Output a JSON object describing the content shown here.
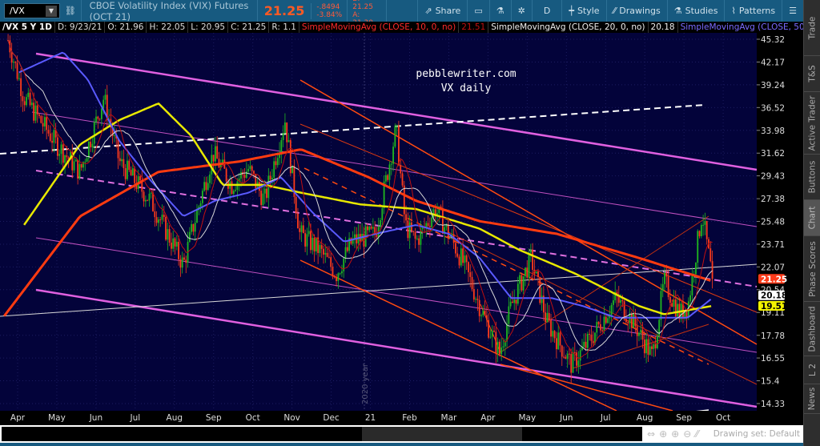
{
  "toolbar": {
    "symbol": "/VX",
    "description": "CBOE Volatility Index (VIX) Futures (OCT 21)",
    "last": "21.25",
    "change": "-.8494",
    "change_pct": "-3.84%",
    "bid": "B: 21.25",
    "ask": "A: 21.30",
    "share": "Share",
    "period": "D",
    "style": "Style",
    "drawings": "Drawings",
    "studies": "Studies",
    "patterns": "Patterns"
  },
  "header": {
    "title": "/VX 5 Y 1D",
    "date": "D: 9/23/21",
    "open": "O: 21.96",
    "high": "H: 22.05",
    "low": "L: 20.95",
    "close": "C: 21.25",
    "range": "R: 1.1",
    "sma10": "SimpleMovingAvg (CLOSE, 10, 0, no)",
    "sma10_val": "21.51",
    "sma20": "SimpleMovingAvg (CLOSE, 20, 0, no)",
    "sma20_val": "20.18",
    "sma50": "SimpleMovingAvg (CLOSE, 50,..."
  },
  "chart": {
    "watermark1": "pebblewriter.com",
    "watermark2": "VX daily",
    "year_label": "2020 year",
    "y_ticks": [
      "45.32",
      "42.17",
      "39.24",
      "36.52",
      "33.98",
      "31.62",
      "29.43",
      "27.38",
      "25.48",
      "23.71",
      "22.07",
      "20.54",
      "19.11",
      "17.78",
      "16.55",
      "15.4",
      "14.33"
    ],
    "y_scale": "log",
    "y_range": [
      14.33,
      45.32
    ],
    "x_ticks": [
      "Apr",
      "May",
      "Jun",
      "Jul",
      "Aug",
      "Sep",
      "Oct",
      "Nov",
      "Dec",
      "21",
      "Feb",
      "Mar",
      "Apr",
      "May",
      "Jun",
      "Jul",
      "Aug",
      "Sep",
      "Oct"
    ],
    "price_tags": [
      {
        "value": "21.25",
        "color": "#ff3b1a"
      },
      {
        "value": "20.18",
        "color": "#ffffff"
      },
      {
        "value": "19.51",
        "color": "#f2f200"
      }
    ],
    "colors": {
      "up": "#1fb81f",
      "down": "#ff3b1a",
      "sma10": "#c01010",
      "sma20": "#d8d8d8",
      "sma50": "#5a5aff",
      "sma100": "#e8e800",
      "sma200": "#ff3b10",
      "background": "#03033a"
    },
    "price_path": [
      [
        "2020-03-24",
        45.2
      ],
      [
        "2020-04-06",
        37.7
      ],
      [
        "2020-05-01",
        32.5
      ],
      [
        "2020-05-19",
        29.8
      ],
      [
        "2020-06-07",
        37.7
      ],
      [
        "2020-06-19",
        30.8
      ],
      [
        "2020-07-13",
        27.2
      ],
      [
        "2020-08-08",
        22.2
      ],
      [
        "2020-08-14",
        24.5
      ],
      [
        "2020-08-31",
        31.6
      ],
      [
        "2020-09-15",
        28.6
      ],
      [
        "2020-09-28",
        30.1
      ],
      [
        "2020-10-10",
        27.2
      ],
      [
        "2020-10-26",
        35.1
      ],
      [
        "2020-11-07",
        24.5
      ],
      [
        "2020-11-22",
        23.3
      ],
      [
        "2020-12-05",
        21.6
      ],
      [
        "2020-12-17",
        23.9
      ],
      [
        "2021-01-05",
        24.5
      ],
      [
        "2021-01-21",
        34.2
      ],
      [
        "2021-01-28",
        25.2
      ],
      [
        "2021-02-06",
        23.9
      ],
      [
        "2021-02-21",
        26.5
      ],
      [
        "2021-03-04",
        23.9
      ],
      [
        "2021-03-13",
        22.2
      ],
      [
        "2021-03-25",
        19.5
      ],
      [
        "2021-04-10",
        16.8
      ],
      [
        "2021-04-19",
        19.5
      ],
      [
        "2021-05-04",
        22.7
      ],
      [
        "2021-05-16",
        18.6
      ],
      [
        "2021-06-05",
        16.2
      ],
      [
        "2021-06-21",
        17.7
      ],
      [
        "2021-07-09",
        20.0
      ],
      [
        "2021-07-22",
        18.6
      ],
      [
        "2021-08-07",
        16.6
      ],
      [
        "2021-08-16",
        21.1
      ],
      [
        "2021-08-28",
        19.0
      ],
      [
        "2021-09-04",
        19.5
      ],
      [
        "2021-09-15",
        26.2
      ],
      [
        "2021-09-23",
        21.25
      ]
    ],
    "sma200_path": [
      [
        "2020-03-21",
        18.9
      ],
      [
        "2020-05-19",
        25.9
      ],
      [
        "2020-07-19",
        29.8
      ],
      [
        "2020-09-21",
        30.8
      ],
      [
        "2020-11-08",
        32.0
      ],
      [
        "2020-12-30",
        29.3
      ],
      [
        "2021-02-06",
        27.2
      ],
      [
        "2021-03-25",
        25.5
      ],
      [
        "2021-05-24",
        24.5
      ],
      [
        "2021-07-27",
        22.7
      ],
      [
        "2021-09-23",
        21.1
      ]
    ],
    "sma100_path": [
      [
        "2020-04-06",
        25.2
      ],
      [
        "2020-05-19",
        32.5
      ],
      [
        "2020-06-19",
        35.1
      ],
      [
        "2020-07-19",
        37.0
      ],
      [
        "2020-08-14",
        33.4
      ],
      [
        "2020-09-08",
        28.6
      ],
      [
        "2020-10-10",
        28.6
      ],
      [
        "2020-11-08",
        27.9
      ],
      [
        "2020-12-23",
        26.9
      ],
      [
        "2021-02-06",
        26.5
      ],
      [
        "2021-03-25",
        24.9
      ],
      [
        "2021-04-25",
        23.3
      ],
      [
        "2021-06-08",
        21.6
      ],
      [
        "2021-07-27",
        19.5
      ],
      [
        "2021-08-16",
        19.0
      ],
      [
        "2021-09-23",
        19.51
      ]
    ],
    "sma50_path": [
      [
        "2020-04-02",
        40.8
      ],
      [
        "2020-05-06",
        43.5
      ],
      [
        "2020-05-25",
        39.9
      ],
      [
        "2020-06-19",
        32.9
      ],
      [
        "2020-07-13",
        29.0
      ],
      [
        "2020-08-08",
        25.9
      ],
      [
        "2020-09-02",
        27.2
      ],
      [
        "2020-09-28",
        27.9
      ],
      [
        "2020-10-23",
        29.3
      ],
      [
        "2020-11-17",
        26.2
      ],
      [
        "2020-12-11",
        23.9
      ],
      [
        "2021-01-05",
        24.5
      ],
      [
        "2021-02-06",
        25.2
      ],
      [
        "2021-03-01",
        24.5
      ],
      [
        "2021-03-25",
        22.7
      ],
      [
        "2021-04-19",
        20.0
      ],
      [
        "2021-05-20",
        20.0
      ],
      [
        "2021-06-14",
        19.5
      ],
      [
        "2021-07-09",
        18.8
      ],
      [
        "2021-08-10",
        18.8
      ],
      [
        "2021-09-04",
        18.8
      ],
      [
        "2021-09-23",
        20.0
      ]
    ]
  },
  "tabs": [
    "Trade",
    "T&S",
    "Active Trader",
    "Buttons",
    "Chart",
    "Phase Scores",
    "Dashboard",
    "L 2",
    "News"
  ],
  "bottom": {
    "drawing_set": "Drawing set: Default"
  }
}
